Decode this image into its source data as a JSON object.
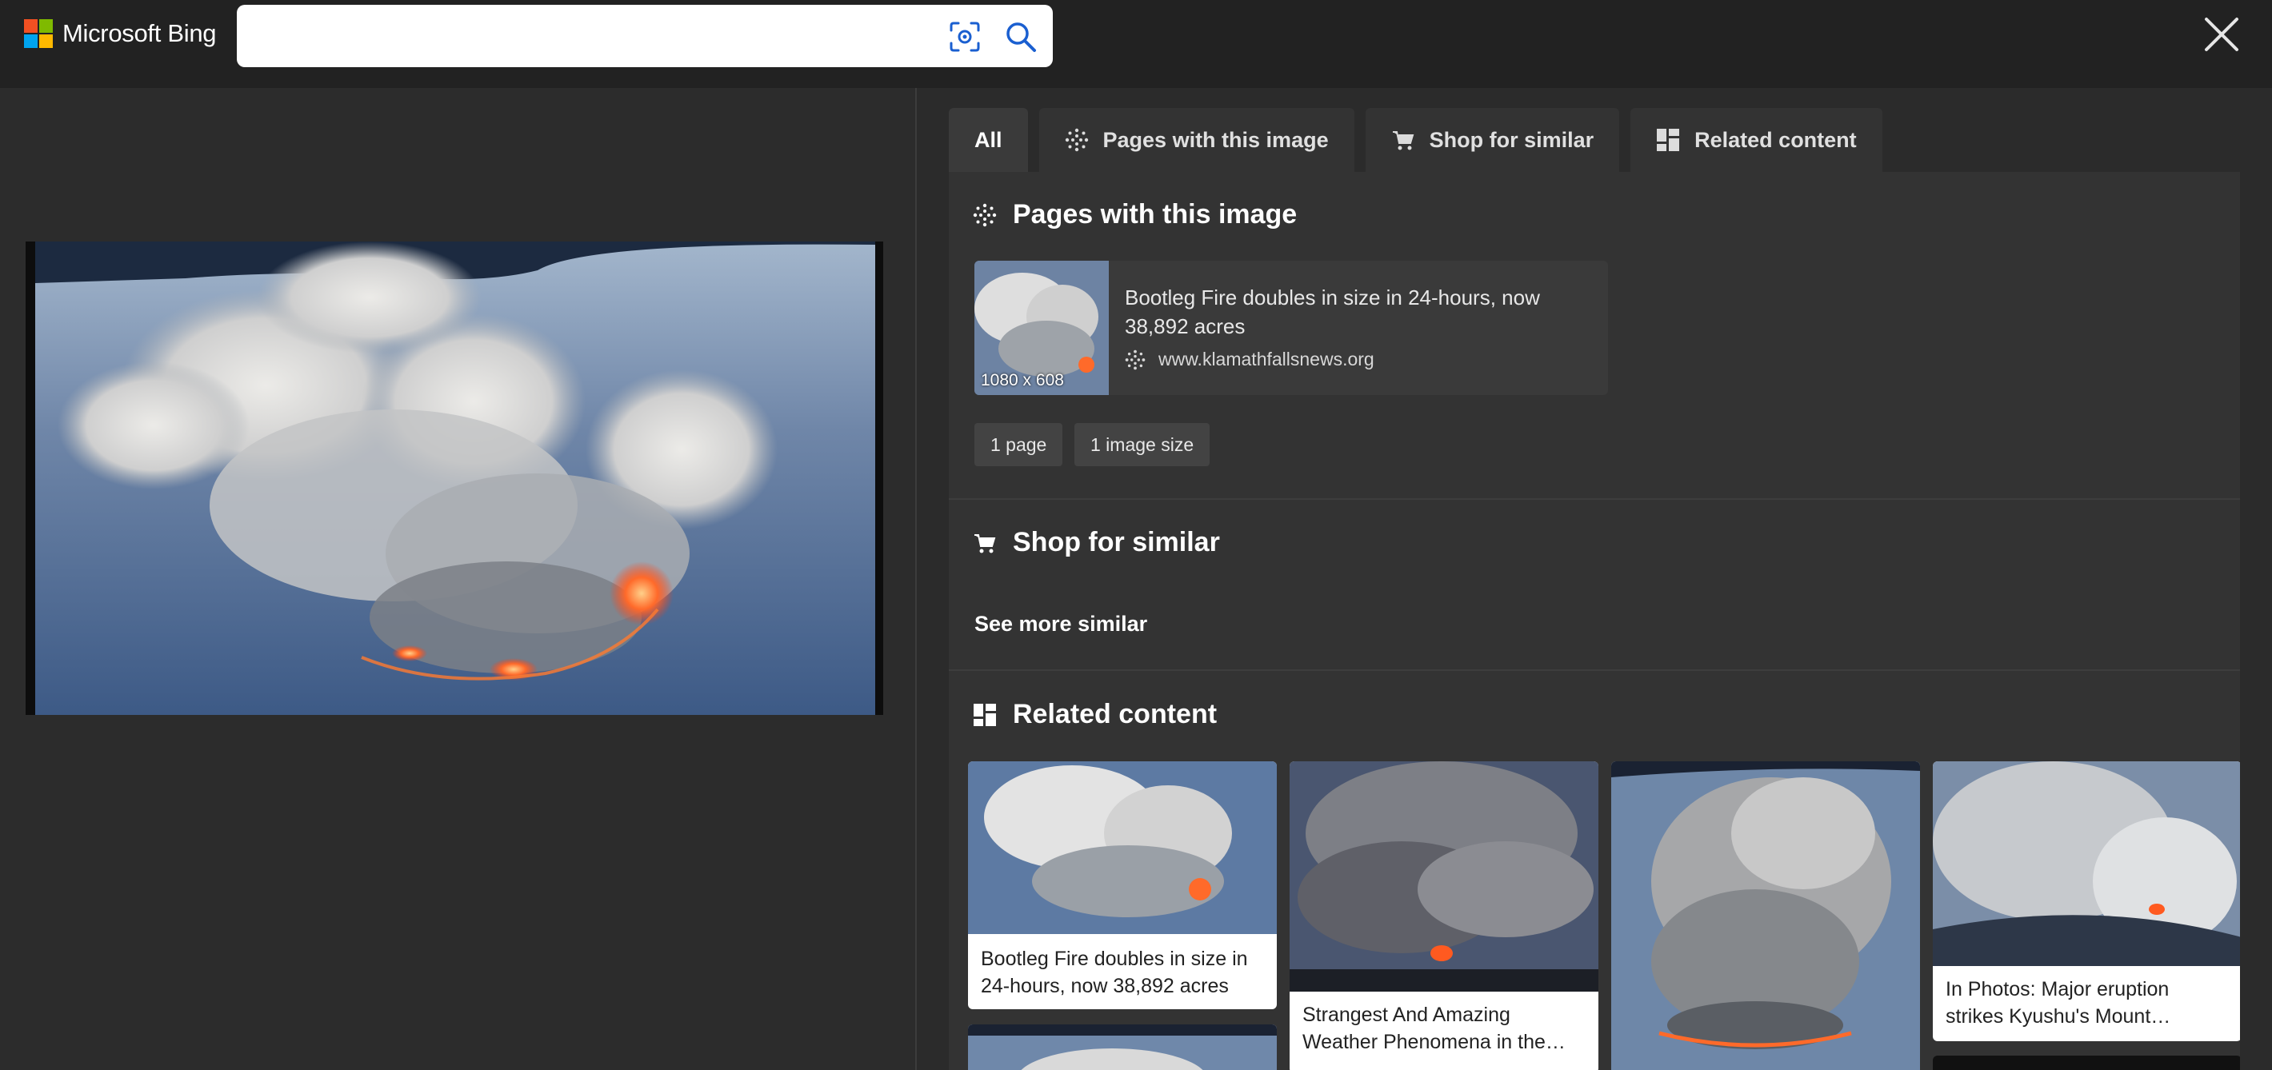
{
  "header": {
    "logo_text": "Microsoft Bing",
    "search_value": "",
    "logo_colors": [
      "#f25022",
      "#7fba00",
      "#00a4ef",
      "#ffb900"
    ]
  },
  "tabs": [
    {
      "label": "All",
      "icon": null,
      "active": true
    },
    {
      "label": "Pages with this image",
      "icon": "globe-icon",
      "active": false
    },
    {
      "label": "Shop for similar",
      "icon": "cart-icon",
      "active": false
    },
    {
      "label": "Related content",
      "icon": "grid-icon",
      "active": false
    }
  ],
  "pages_section": {
    "title": "Pages with this image",
    "card": {
      "title": "Bootleg Fire doubles in size in 24-hours, now 38,892 acres",
      "url": "www.klamathfallsnews.org",
      "thumb_size": "1080 x 608"
    },
    "chips": [
      "1 page",
      "1 image size"
    ]
  },
  "shop_section": {
    "title": "Shop for similar",
    "see_more": "See more similar"
  },
  "related_section": {
    "title": "Related content",
    "items": [
      {
        "caption": "Bootleg Fire doubles in size in 24-hours, now 38,892 acres"
      },
      {
        "caption": "Strangest And Amazing Weather Phenomena in the…"
      },
      {
        "caption": ""
      },
      {
        "caption": "In Photos: Major eruption strikes Kyushu's Mount…"
      }
    ]
  }
}
